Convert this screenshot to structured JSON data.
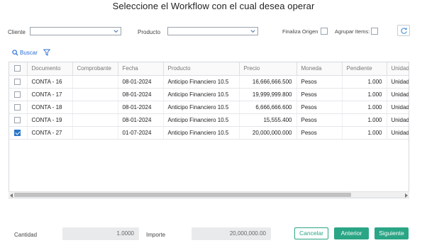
{
  "dialog": {
    "title": "Seleccione el Workflow con el cual desea operar"
  },
  "filters": {
    "cliente_label": "Cliente",
    "cliente_value": "",
    "producto_label": "Producto",
    "producto_value": "",
    "finaliza_origen_label": "Finaliza Origen",
    "agrupar_items_label": "Agrupar Items:"
  },
  "toolbar": {
    "buscar_label": "Buscar"
  },
  "grid": {
    "columns": [
      "Documento",
      "Comprobante",
      "Fecha",
      "Producto",
      "Precio",
      "Moneda",
      "Pendiente",
      "Unidad"
    ],
    "rows": [
      {
        "documento": "CONTA - 16",
        "comprobante": "",
        "fecha": "08-01-2024",
        "producto": "Anticipo Financiero 10.5",
        "precio": "16,666,666.500",
        "moneda": "Pesos",
        "pendiente": "1.000",
        "unidad": "Unidad",
        "checked": false
      },
      {
        "documento": "CONTA - 17",
        "comprobante": "",
        "fecha": "08-01-2024",
        "producto": "Anticipo Financiero 10.5",
        "precio": "19,999,999.800",
        "moneda": "Pesos",
        "pendiente": "1.000",
        "unidad": "Unidad",
        "checked": false
      },
      {
        "documento": "CONTA - 18",
        "comprobante": "",
        "fecha": "08-01-2024",
        "producto": "Anticipo Financiero 10.5",
        "precio": "6,666,666.600",
        "moneda": "Pesos",
        "pendiente": "1.000",
        "unidad": "Unidad",
        "checked": false
      },
      {
        "documento": "CONTA - 19",
        "comprobante": "",
        "fecha": "08-01-2024",
        "producto": "Anticipo Financiero 10.5",
        "precio": "15,555.400",
        "moneda": "Pesos",
        "pendiente": "1.000",
        "unidad": "Unidad",
        "checked": false
      },
      {
        "documento": "CONTA - 27",
        "comprobante": "",
        "fecha": "01-07-2024",
        "producto": "Anticipo Financiero 10.5",
        "precio": "20,000,000.000",
        "moneda": "Pesos",
        "pendiente": "1.000",
        "unidad": "Unidad",
        "checked": true
      }
    ]
  },
  "footer": {
    "cantidad_label": "Cantidad",
    "cantidad_value": "1.0000",
    "importe_label": "Importe",
    "importe_value": "20,000,000.00",
    "cancelar_label": "Cancelar",
    "anterior_label": "Anterior",
    "siguiente_label": "Siguiente"
  },
  "colors": {
    "accent": "#2aa585",
    "link": "#2a6fd6",
    "checkbox_checked": "#2a78c9"
  },
  "icons": [
    "chevron-down-icon",
    "refresh-icon",
    "search-icon",
    "filter-icon",
    "check-icon"
  ]
}
